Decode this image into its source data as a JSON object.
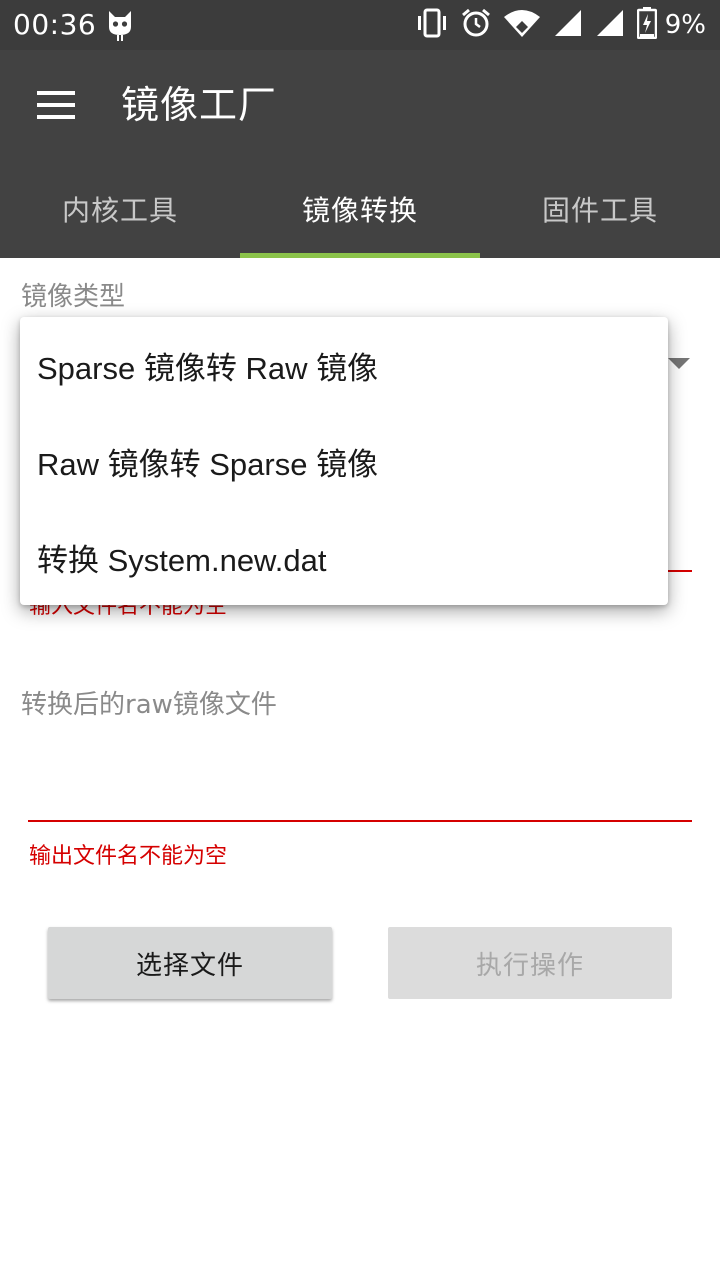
{
  "status_bar": {
    "time": "00:36",
    "battery_percent": "9%",
    "icons": [
      "cat-notification-icon",
      "vibrate-icon",
      "alarm-icon",
      "wifi-icon",
      "signal-icon",
      "signal-icon",
      "battery-charging-icon"
    ]
  },
  "app_bar": {
    "title": "镜像工厂",
    "menu_icon": "hamburger-menu-icon"
  },
  "tabs": [
    {
      "label": "内核工具",
      "active": false
    },
    {
      "label": "镜像转换",
      "active": true
    },
    {
      "label": "固件工具",
      "active": false
    }
  ],
  "form": {
    "image_type_label": "镜像类型",
    "input_error": "输入文件名不能为空",
    "output_label": "转换后的raw镜像文件",
    "output_error": "输出文件名不能为空"
  },
  "dropdown": {
    "options": [
      "Sparse 镜像转 Raw 镜像",
      "Raw 镜像转 Sparse 镜像",
      "转换 System.new.dat"
    ]
  },
  "buttons": {
    "select_file": "选择文件",
    "execute": "执行操作"
  },
  "colors": {
    "appbar": "#424242",
    "statusbar": "#3c3c3c",
    "tab_indicator": "#8bc34a",
    "error": "#d50000"
  }
}
